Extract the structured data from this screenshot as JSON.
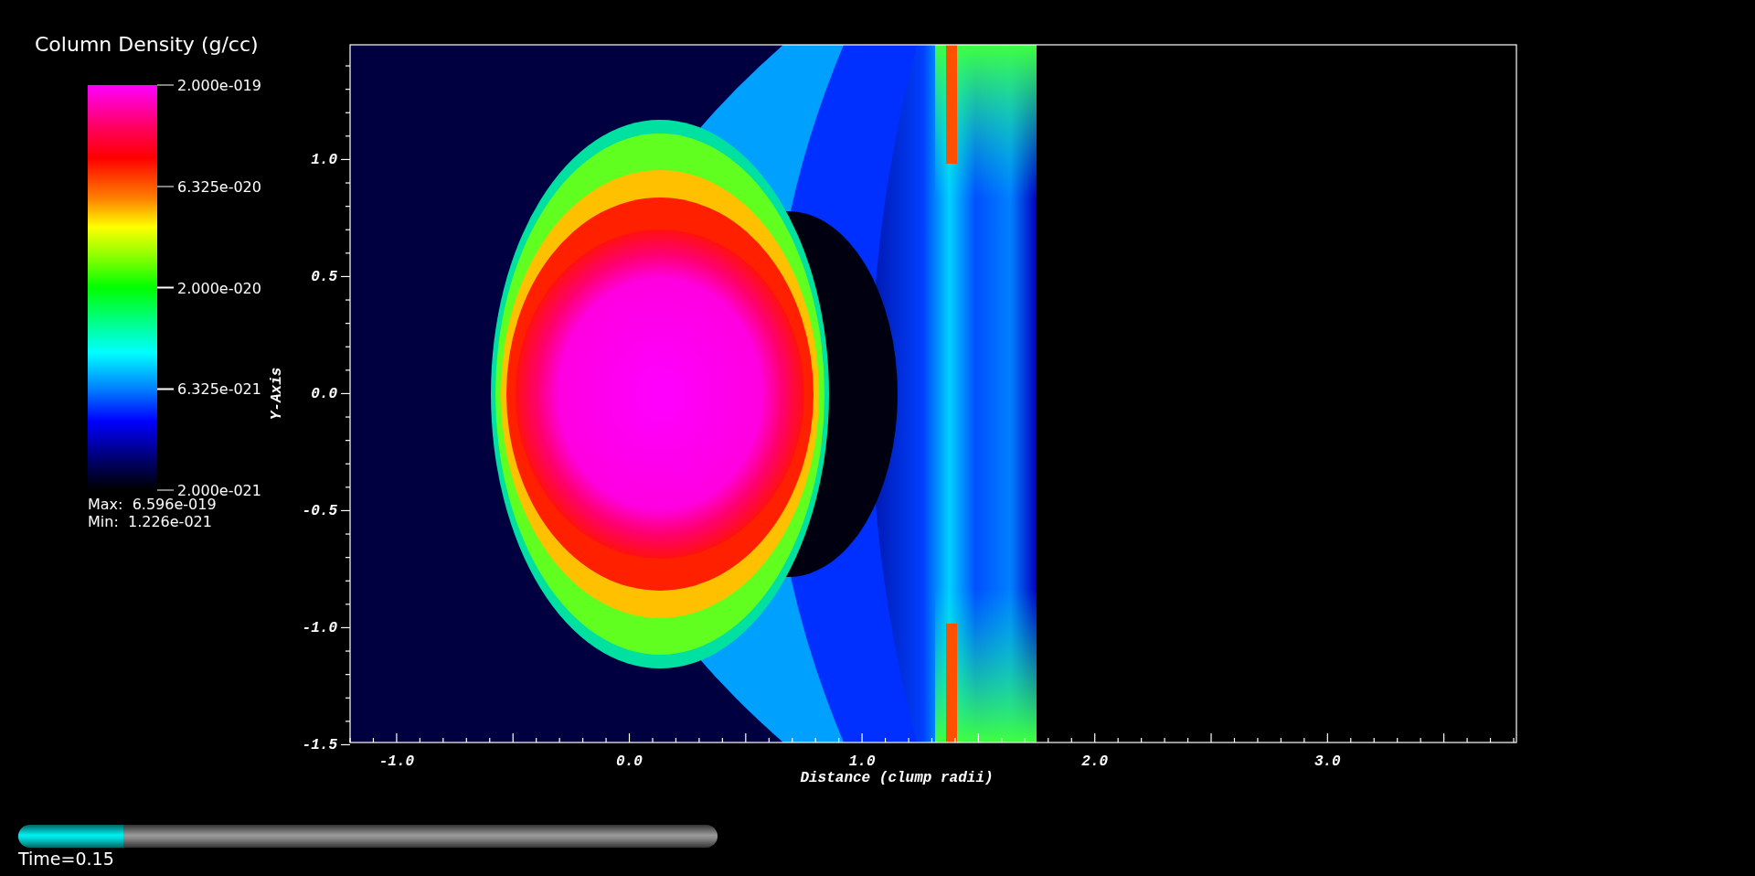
{
  "legend": {
    "title": "Column Density (g/cc)",
    "tick_labels": [
      "2.000e-019",
      "6.325e-020",
      "2.000e-020",
      "6.325e-021",
      "2.000e-021"
    ],
    "max": "Max:  6.596e-019",
    "min": "Min:  1.226e-021"
  },
  "plot": {
    "xaxis": {
      "title": "Distance (clump radii)",
      "tick_labels": [
        "-1.0",
        "0.0",
        "1.0",
        "2.0",
        "3.0"
      ]
    },
    "yaxis": {
      "title": "Y-Axis",
      "tick_labels": [
        "1.0",
        "0.5",
        "0.0",
        "-0.5",
        "-1.0",
        "-1.5"
      ]
    }
  },
  "time_slider": {
    "label": "Time=0.15",
    "level": 0.15
  }
}
